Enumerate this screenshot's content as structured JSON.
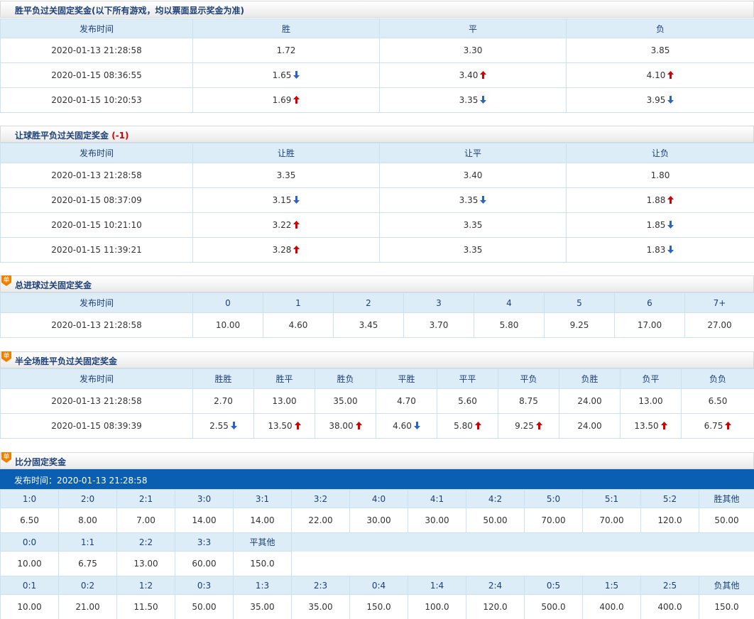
{
  "colors": {
    "up": "#d40000",
    "down": "#2b63c0",
    "header_text": "#1c3f78",
    "table_head_bg": "#dcedf8",
    "bar_bg": "#0a5fb2",
    "badge": "#f07f00"
  },
  "badge_label": "单",
  "spf": {
    "title": "胜平负过关固定奖金(以下所有游戏，均以票面显示奖金为准)",
    "headers": [
      "发布时间",
      "胜",
      "平",
      "负"
    ],
    "rows": [
      {
        "time": "2020-01-13 21:28:58",
        "vals": [
          "1.72",
          "3.30",
          "3.85"
        ],
        "dirs": [
          "",
          "",
          ""
        ]
      },
      {
        "time": "2020-01-15 08:36:55",
        "vals": [
          "1.65",
          "3.40",
          "4.10"
        ],
        "dirs": [
          "down",
          "up",
          "up"
        ]
      },
      {
        "time": "2020-01-15 10:20:53",
        "vals": [
          "1.69",
          "3.35",
          "3.95"
        ],
        "dirs": [
          "up",
          "down",
          "down"
        ]
      }
    ]
  },
  "rqspf": {
    "title": "让球胜平负过关固定奖金",
    "handicap": "(-1)",
    "headers": [
      "发布时间",
      "让胜",
      "让平",
      "让负"
    ],
    "rows": [
      {
        "time": "2020-01-13 21:28:58",
        "vals": [
          "3.35",
          "3.40",
          "1.80"
        ],
        "dirs": [
          "",
          "",
          ""
        ]
      },
      {
        "time": "2020-01-15 08:37:09",
        "vals": [
          "3.15",
          "3.35",
          "1.88"
        ],
        "dirs": [
          "down",
          "down",
          "up"
        ]
      },
      {
        "time": "2020-01-15 10:21:10",
        "vals": [
          "3.22",
          "3.35",
          "1.85"
        ],
        "dirs": [
          "up",
          "",
          "down"
        ]
      },
      {
        "time": "2020-01-15 11:39:21",
        "vals": [
          "3.28",
          "3.35",
          "1.83"
        ],
        "dirs": [
          "up",
          "",
          "down"
        ]
      }
    ]
  },
  "zjq": {
    "title": "总进球过关固定奖金",
    "headers": [
      "发布时间",
      "0",
      "1",
      "2",
      "3",
      "4",
      "5",
      "6",
      "7+"
    ],
    "rows": [
      {
        "time": "2020-01-13 21:28:58",
        "vals": [
          "10.00",
          "4.60",
          "3.45",
          "3.70",
          "5.80",
          "9.25",
          "17.00",
          "27.00"
        ],
        "dirs": [
          "",
          "",
          "",
          "",
          "",
          "",
          "",
          ""
        ]
      }
    ]
  },
  "bqc": {
    "title": "半全场胜平负过关固定奖金",
    "headers": [
      "发布时间",
      "胜胜",
      "胜平",
      "胜负",
      "平胜",
      "平平",
      "平负",
      "负胜",
      "负平",
      "负负"
    ],
    "rows": [
      {
        "time": "2020-01-13 21:28:58",
        "vals": [
          "2.70",
          "13.00",
          "35.00",
          "4.70",
          "5.60",
          "8.75",
          "24.00",
          "13.00",
          "6.50"
        ],
        "dirs": [
          "",
          "",
          "",
          "",
          "",
          "",
          "",
          "",
          ""
        ]
      },
      {
        "time": "2020-01-15 08:39:39",
        "vals": [
          "2.55",
          "13.50",
          "38.00",
          "4.60",
          "5.80",
          "9.25",
          "24.00",
          "13.50",
          "6.75"
        ],
        "dirs": [
          "down",
          "up",
          "up",
          "down",
          "up",
          "up",
          "",
          "up",
          "up"
        ]
      }
    ]
  },
  "bf": {
    "title": "比分固定奖金",
    "time_label": "发布时间：2020-01-13 21:28:58",
    "win_headers": [
      "1:0",
      "2:0",
      "2:1",
      "3:0",
      "3:1",
      "3:2",
      "4:0",
      "4:1",
      "4:2",
      "5:0",
      "5:1",
      "5:2",
      "胜其他"
    ],
    "win_vals": [
      "6.50",
      "8.00",
      "7.00",
      "14.00",
      "14.00",
      "22.00",
      "30.00",
      "30.00",
      "50.00",
      "70.00",
      "70.00",
      "120.0",
      "50.00"
    ],
    "draw_headers": [
      "0:0",
      "1:1",
      "2:2",
      "3:3",
      "平其他"
    ],
    "draw_vals": [
      "10.00",
      "6.75",
      "13.00",
      "60.00",
      "150.0"
    ],
    "lose_headers": [
      "0:1",
      "0:2",
      "1:2",
      "0:3",
      "1:3",
      "2:3",
      "0:4",
      "1:4",
      "2:4",
      "0:5",
      "1:5",
      "2:5",
      "负其他"
    ],
    "lose_vals": [
      "10.00",
      "21.00",
      "11.50",
      "50.00",
      "35.00",
      "35.00",
      "150.0",
      "100.0",
      "120.0",
      "500.0",
      "400.0",
      "400.0",
      "150.0"
    ]
  }
}
